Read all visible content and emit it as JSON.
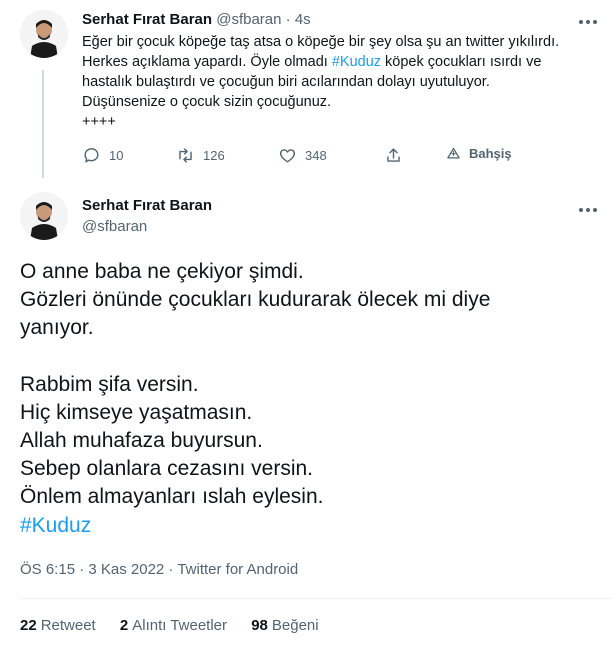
{
  "parent_tweet": {
    "author_name": "Serhat Fırat Baran",
    "author_handle": "@sfbaran",
    "separator": "·",
    "time": "4s",
    "text_lines": [
      "Eğer bir çocuk köpeğe taş atsa o köpeğe bir şey olsa şu an twitter yıkılırdı.",
      "Herkes açıklama yapardı. Öyle olmadı ",
      " köpek çocukları ısırdı ve",
      "hastalık bulaştırdı ve çocuğun biri acılarından dolayı uyutuluyor.",
      "Düşünsenize o çocuk sizin çocuğunuz.",
      "++++"
    ],
    "hashtag": "#Kuduz",
    "reply_count": "10",
    "retweet_count": "126",
    "like_count": "348",
    "tip_label": "Bahşiş"
  },
  "main_tweet": {
    "author_name": "Serhat Fırat Baran",
    "author_handle": "@sfbaran",
    "lines": [
      "O anne baba ne çekiyor şimdi.",
      "Gözleri önünde çocukları kudurarak ölecek mi diye",
      "yanıyor.",
      "Rabbim şifa versin.",
      "Hiç kimseye yaşatmasın.",
      "Allah muhafaza buyursun.",
      "Sebep olanlara cezasını versin.",
      "Önlem almayanları ıslah eylesin."
    ],
    "hashtag": "#Kuduz",
    "timestamp": "ÖS 6:15 · 3 Kas 2022 · Twitter for Android",
    "retweets_count": "22",
    "retweets_label": "Retweet",
    "quotes_count": "2",
    "quotes_label": "Alıntı Tweetler",
    "likes_count": "98",
    "likes_label": "Beğeni"
  },
  "colors": {
    "accent": "#1d9bf0",
    "text": "#0f1419",
    "muted": "#536471",
    "divider": "#eff3f4"
  },
  "icons": [
    "avatar",
    "more-icon",
    "reply-icon",
    "retweet-icon",
    "like-icon",
    "share-icon",
    "tip-icon"
  ]
}
